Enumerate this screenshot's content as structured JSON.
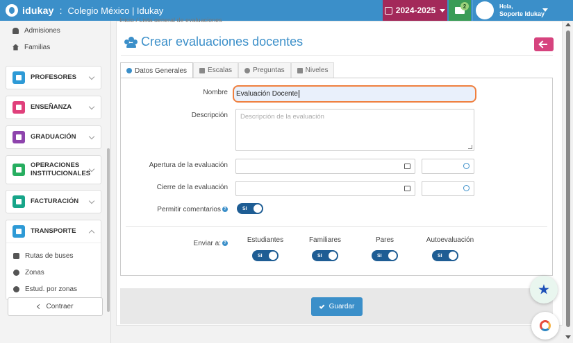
{
  "topbar": {
    "brand": "idukay",
    "separator": ":",
    "school": "Colegio México | Idukay",
    "year": "2024-2025",
    "messages_badge": "2",
    "user_greeting": "Hola,",
    "user_name": "Soporte Idukay"
  },
  "breadcrumb": "Inicio / Lista general de evaluaciones",
  "sidebar": {
    "top_items": [
      {
        "label": "Admisiones",
        "icon": "people-icon"
      },
      {
        "label": "Familias",
        "icon": "home-icon"
      }
    ],
    "menus": [
      {
        "label": "PROFESORES",
        "color": "#2e9ad6",
        "icon": "teacher-icon"
      },
      {
        "label": "ENSEÑANZA",
        "color": "#e0407b",
        "icon": "book-icon"
      },
      {
        "label": "GRADUACIÓN",
        "color": "#8e44ad",
        "icon": "file-icon"
      },
      {
        "label": "OPERACIONES",
        "label2": "INSTITUCIONALES",
        "color": "#27ae60",
        "icon": "chat-icon"
      },
      {
        "label": "FACTURACIÓN",
        "color": "#17a589",
        "icon": "calculator-icon"
      },
      {
        "label": "TRANSPORTE",
        "color": "#2e9ad6",
        "icon": "bus-icon"
      }
    ],
    "transport_items": [
      {
        "label": "Rutas de buses",
        "icon": "bus-icon"
      },
      {
        "label": "Zonas",
        "icon": "globe-icon"
      },
      {
        "label": "Estud. por zonas",
        "icon": "globe-icon"
      }
    ],
    "collapse": "Contraer"
  },
  "page": {
    "title": "Crear evaluaciones docentes",
    "tabs": [
      {
        "label": "Datos Generales",
        "icon": "info-icon"
      },
      {
        "label": "Escalas",
        "icon": "list-icon"
      },
      {
        "label": "Preguntas",
        "icon": "question-icon"
      },
      {
        "label": "Niveles",
        "icon": "hierarchy-icon"
      }
    ]
  },
  "form": {
    "name_label": "Nombre",
    "name_value": "Evaluación Docente",
    "description_label": "Descripción",
    "description_placeholder": "Descripción de la evaluación",
    "opening_label": "Apertura de la evaluación",
    "closing_label": "Cierre de la evaluación",
    "comments_label": "Permitir comentarios",
    "comments_toggle": "SI",
    "send_label": "Enviar a:",
    "recipients": [
      {
        "label": "Estudiantes",
        "toggle": "SI"
      },
      {
        "label": "Familiares",
        "toggle": "SI"
      },
      {
        "label": "Pares",
        "toggle": "SI"
      },
      {
        "label": "Autoevaluación",
        "toggle": "SI"
      }
    ]
  },
  "actions": {
    "save": "Guardar"
  },
  "colors": {
    "primary": "#3b8fc9",
    "year_button": "#a3295a",
    "messages_button": "#3a9c57",
    "back_button": "#d6437e",
    "active_input_border": "#ef7f3e",
    "toggle": "#1e5d94"
  }
}
